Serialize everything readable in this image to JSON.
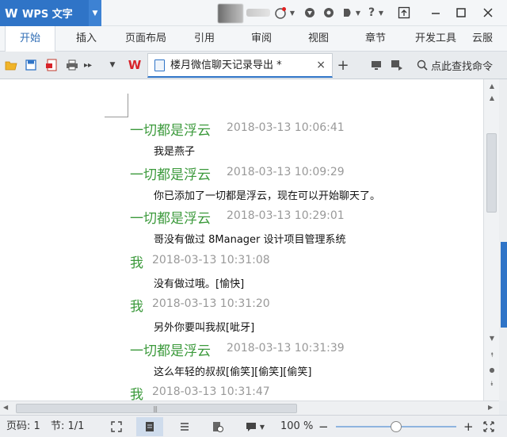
{
  "app": {
    "logo": "W",
    "name": "WPS 文字"
  },
  "ribbon": {
    "tabs": [
      "开始",
      "插入",
      "页面布局",
      "引用",
      "审阅",
      "视图",
      "章节",
      "开发工具",
      "云服"
    ],
    "active_tab": 0
  },
  "toolbar": {
    "wps_logo": "W",
    "doc_tab_title": "楼月微信聊天记录导出 *",
    "doc_tab_close": "×",
    "new_tab": "+",
    "search_command": "点此查找命令"
  },
  "document": {
    "entries": [
      {
        "sender": "一切都是浮云",
        "time": "2018-03-13 10:06:41",
        "message": "我是燕子"
      },
      {
        "sender": "一切都是浮云",
        "time": "2018-03-13 10:09:29",
        "message": "你已添加了一切都是浮云，现在可以开始聊天了。"
      },
      {
        "sender": "一切都是浮云",
        "time": "2018-03-13 10:29:01",
        "message": "哥没有做过 8Manager 设计项目管理系统"
      },
      {
        "sender": "我",
        "time": "2018-03-13 10:31:08",
        "message": "没有做过哦。[愉快]"
      },
      {
        "sender": "我",
        "time": "2018-03-13 10:31:20",
        "message": "另外你要叫我叔[呲牙]"
      },
      {
        "sender": "一切都是浮云",
        "time": "2018-03-13 10:31:39",
        "message": "这么年轻的叔叔[偷笑][偷笑][偷笑]"
      },
      {
        "sender": "我",
        "time": "2018-03-13 10:31:47",
        "message": ""
      }
    ]
  },
  "statusbar": {
    "page": "页码: 1",
    "section": "节: 1/1",
    "zoom": "100 %",
    "zoom_minus": "−",
    "zoom_plus": "+",
    "zoom_level": 0.5
  },
  "colors": {
    "accent": "#2f74c7",
    "sender_green": "#3c9a3c",
    "timestamp_gray": "#999999",
    "wps_red": "#d8232a"
  }
}
